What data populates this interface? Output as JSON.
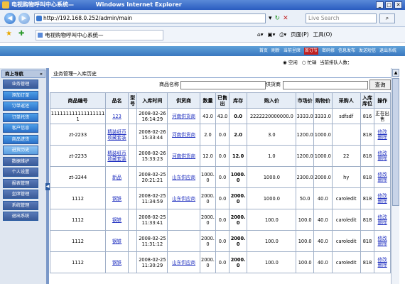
{
  "window": {
    "title": "电视购物呼叫中心系统—",
    "browser": "Windows Internet Explorer",
    "controls": [
      "_",
      "□",
      "✕"
    ]
  },
  "addressbar": {
    "url": "http://192.168.0.252/admin/main",
    "search_placeholder": "Live Search"
  },
  "commandbar": {
    "tab_title": "电视购物呼叫中心系统—",
    "page_menu": "页面(P)",
    "tools_menu": "工具(O)"
  },
  "toplinks": [
    "首页",
    "刷新",
    "当前呈席",
    "首订节",
    "密码修",
    "信息发布",
    "发送短信",
    "退出系统"
  ],
  "status": {
    "idle": "空闲",
    "busy": "忙碌",
    "queue": "当前排队人数："
  },
  "sidebar": {
    "title": "商上导航",
    "items": [
      {
        "label": "业务管理",
        "style": "dark"
      },
      {
        "label": "添加订单",
        "style": "normal"
      },
      {
        "label": "订单返还",
        "style": "normal"
      },
      {
        "label": "订单托货",
        "style": "normal"
      },
      {
        "label": "客户信息",
        "style": "normal"
      },
      {
        "label": "商品进货",
        "style": "normal"
      },
      {
        "label": "进货历史",
        "style": "active"
      },
      {
        "label": "数据维护",
        "style": "dark"
      },
      {
        "label": "个人设置",
        "style": "dark"
      },
      {
        "label": "报表管理",
        "style": "dark"
      },
      {
        "label": "坐席管理",
        "style": "dark"
      },
      {
        "label": "系统管理",
        "style": "dark"
      },
      {
        "label": "退出系统",
        "style": "dark"
      }
    ]
  },
  "breadcrumb": "业务管理--入库历史",
  "filter": {
    "product_label": "商品名称",
    "supplier_label": "供货商",
    "query_button": "查询"
  },
  "table": {
    "headers": [
      "商品编号",
      "品名",
      "型号",
      "入库时间",
      "供货商",
      "数量",
      "已售出",
      "库存",
      "购入价",
      "市场价",
      "购物价",
      "采购人",
      "入库库位",
      "操作"
    ],
    "rows": [
      {
        "code": "1111111111111111111",
        "name": "123",
        "model": "",
        "time": "2008-02-26 16:14:29",
        "supplier": "河南供货商",
        "qty": "43.0",
        "sold": "43.0",
        "stock": "0.0",
        "buy": "2222220000000.0",
        "market": "3333.0",
        "shop": "3333.0",
        "buyer": "sdfsdf",
        "loc": "816",
        "op": "正在出售"
      },
      {
        "code": "zt-2233",
        "name": "精装纸币收藏套装",
        "model": "",
        "time": "2008-02-26 15:33:44",
        "supplier": "河南供货商",
        "qty": "2.0",
        "sold": "0.0",
        "stock": "2.0",
        "buy": "3.0",
        "market": "1200.0",
        "shop": "1000.0",
        "buyer": "",
        "loc": "818",
        "op": "修改 删除"
      },
      {
        "code": "zt-2233",
        "name": "精装纸币收藏套装",
        "model": "",
        "time": "2008-02-26 15:33:23",
        "supplier": "河南供货商",
        "qty": "12.0",
        "sold": "0.0",
        "stock": "12.0",
        "buy": "1.0",
        "market": "1200.0",
        "shop": "1000.0",
        "buyer": "22",
        "loc": "818",
        "op": "修改 删除"
      },
      {
        "code": "zt-3344",
        "name": "新品",
        "model": "",
        "time": "2008-02-25 20:21:21",
        "supplier": "山东供应商",
        "qty": "1000.0",
        "sold": "0.0",
        "stock": "1000.0",
        "buy": "1000.0",
        "market": "2300.0",
        "shop": "2000.0",
        "buyer": "hy",
        "loc": "818",
        "op": "修改 删除"
      },
      {
        "code": "1112",
        "name": "钢铁",
        "model": "",
        "time": "2008-02-25 11:34:59",
        "supplier": "山东供应商",
        "qty": "2000.0",
        "sold": "0.0",
        "stock": "2000.0",
        "buy": "1000.0",
        "market": "50.0",
        "shop": "40.0",
        "buyer": "caroledit",
        "loc": "818",
        "op": "修改 删除"
      },
      {
        "code": "1112",
        "name": "钢铁",
        "model": "",
        "time": "2008-02-25 11:33:41",
        "supplier": "",
        "qty": "2000.0",
        "sold": "0.0",
        "stock": "2000.0",
        "buy": "100.0",
        "market": "100.0",
        "shop": "40.0",
        "buyer": "caroledit",
        "loc": "818",
        "op": "修改 删除"
      },
      {
        "code": "1112",
        "name": "钢铁",
        "model": "",
        "time": "2008-02-25 11:31:12",
        "supplier": "",
        "qty": "2000.0",
        "sold": "0.0",
        "stock": "2000.0",
        "buy": "100.0",
        "market": "100.0",
        "shop": "40.0",
        "buyer": "caroledit",
        "loc": "818",
        "op": "修改 删除"
      },
      {
        "code": "1112",
        "name": "钢铁",
        "model": "",
        "time": "2008-02-25 11:30:29",
        "supplier": "山东供应商",
        "qty": "2000.0",
        "sold": "0.0",
        "stock": "2000.0",
        "buy": "100.0",
        "market": "100.0",
        "shop": "40.0",
        "buyer": "caroledit",
        "loc": "818",
        "op": "修改 删除"
      }
    ]
  }
}
